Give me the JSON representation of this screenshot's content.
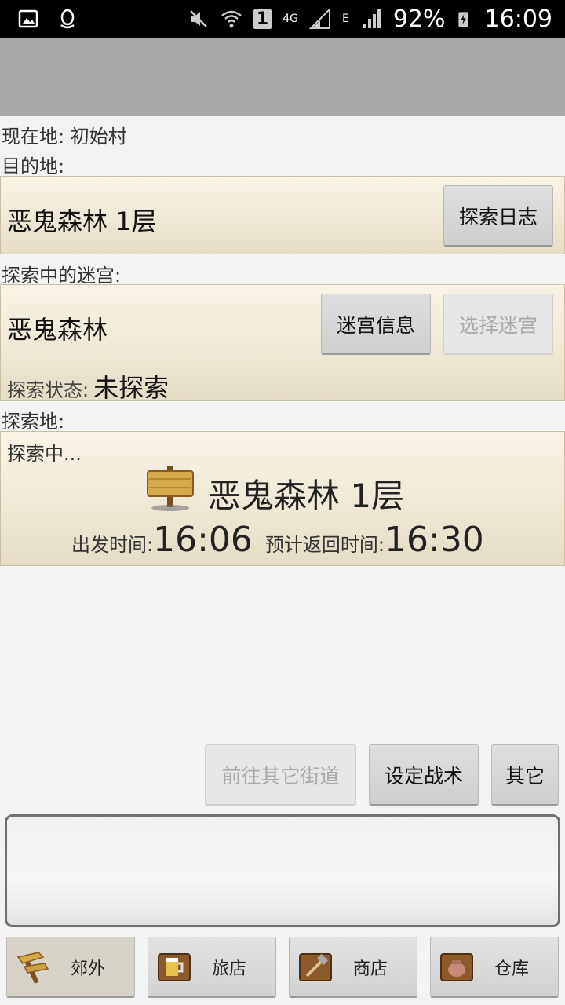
{
  "status_bar": {
    "battery": "92%",
    "time": "16:09",
    "network_4g": "4G",
    "network_e": "E",
    "sim": "1"
  },
  "location": {
    "current_label": "现在地: 初始村",
    "destination_label": "目的地:"
  },
  "destination_panel": {
    "name": "恶鬼森林 1层",
    "log_button": "探索日志"
  },
  "maze_section": {
    "label": "探索中的迷宫:",
    "name": "恶鬼森林",
    "info_button": "迷宫信息",
    "select_button": "选择迷宫",
    "status_label": "探索状态:",
    "status_value": "未探索"
  },
  "explore_section": {
    "label": "探索地:",
    "state": "探索中...",
    "place": "恶鬼森林 1层",
    "depart_label": "出发时间:",
    "depart_time": "16:06",
    "return_label": "预计返回时间:",
    "return_time": "16:30"
  },
  "actions": {
    "other_street": "前往其它街道",
    "set_tactics": "设定战术",
    "other": "其它"
  },
  "nav": {
    "items": [
      {
        "label": "郊外"
      },
      {
        "label": "旅店"
      },
      {
        "label": "商店"
      },
      {
        "label": "仓库"
      }
    ]
  }
}
